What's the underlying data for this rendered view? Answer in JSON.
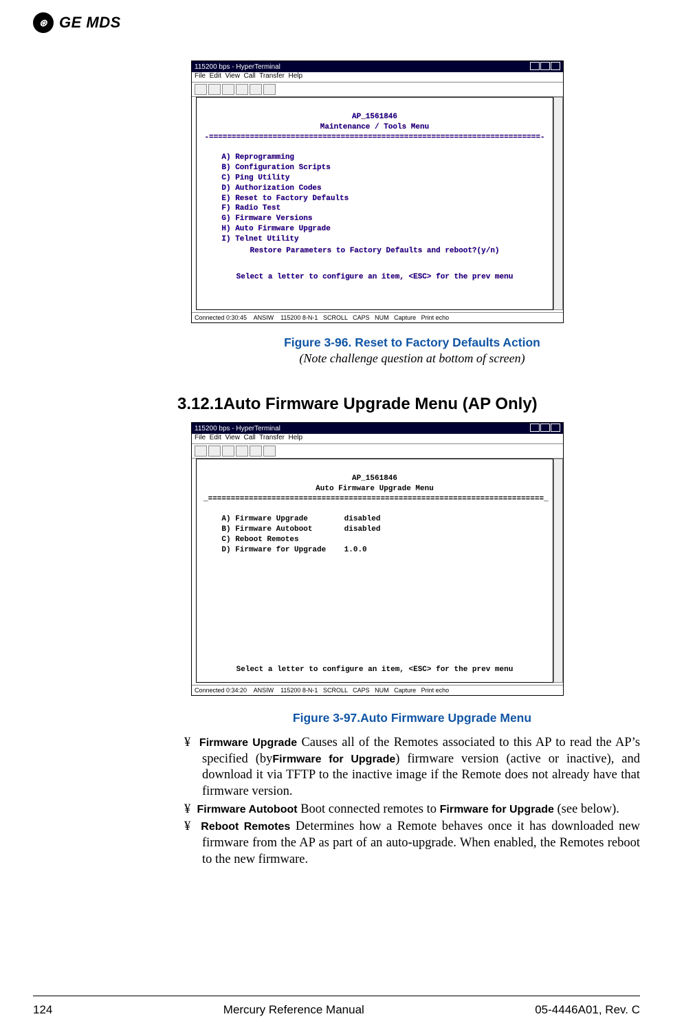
{
  "header": {
    "brand": "GE MDS",
    "badge": "⊛"
  },
  "term1": {
    "title": "115200 bps - HyperTerminal",
    "menubar": "File  Edit  View  Call  Transfer  Help",
    "hdr1": "AP_1561846",
    "hdr2": "Maintenance / Tools Menu",
    "sep": "-=========================================================================-",
    "a": "A) Reprogramming",
    "b": "B) Configuration Scripts",
    "c": "C) Ping Utility",
    "d": "D) Authorization Codes",
    "e": "E) Reset to Factory Defaults",
    "f": "F) Radio Test",
    "g": "G) Firmware Versions",
    "h": "H) Auto Firmware Upgrade",
    "i": "I) Telnet Utility",
    "prompt": "Restore Parameters to Factory Defaults and reboot?(y/n)",
    "hint": "Select a letter to configure an item, <ESC> for the prev menu",
    "status": "Connected 0:30:45    ANSIW    115200 8-N-1   SCROLL   CAPS   NUM   Capture   Print echo"
  },
  "figcap1": "Figure 3-96. Reset to Factory Defaults Action",
  "figsub1": "(Note challenge question at bottom of screen)",
  "section": "3.12.1Auto Firmware Upgrade Menu (AP Only)",
  "term2": {
    "title": "115200 bps - HyperTerminal",
    "menubar": "File  Edit  View  Call  Transfer  Help",
    "hdr1": "AP_1561846",
    "hdr2": "Auto Firmware Upgrade Menu",
    "sep": "_==========================================================================_",
    "a": "A) Firmware Upgrade        disabled",
    "b": "B) Firmware Autoboot       disabled",
    "c": "C) Reboot Remotes",
    "d": "D) Firmware for Upgrade    1.0.0",
    "hint": "Select a letter to configure an item, <ESC> for the prev menu",
    "status": "Connected 0:34:20    ANSIW    115200 8-N-1   SCROLL   CAPS   NUM   Capture   Print echo"
  },
  "figcap2": "Figure 3-97.Auto Firmware Upgrade Menu",
  "b1": {
    "marker": "¥",
    "label": "Firmware Upgrade",
    "text1": "Causes all of the Remotes associated to this AP to read the AP’s specified (by",
    "inline": "Firmware for Upgrade",
    "text2": ") firmware version (active or inactive), and download it via TFTP to the inactive image if the Remote does not already have that firm­ware version."
  },
  "b2": {
    "marker": "¥",
    "label": "Firmware Autoboot",
    "text1": "Boot connected remotes to ",
    "inline": "Firmware for Upgrade",
    "text2": " (see below)."
  },
  "b3": {
    "marker": "¥",
    "label": "Reboot Remotes",
    "text": "Determines how a Remote behaves once it has downloaded new firmware from the AP as part of an auto-upgrade. When enabled, the Remotes reboot to the new firmware."
  },
  "footer": {
    "page": "124",
    "center": "Mercury Reference Manual",
    "right": "05-4446A01, Rev. C"
  }
}
